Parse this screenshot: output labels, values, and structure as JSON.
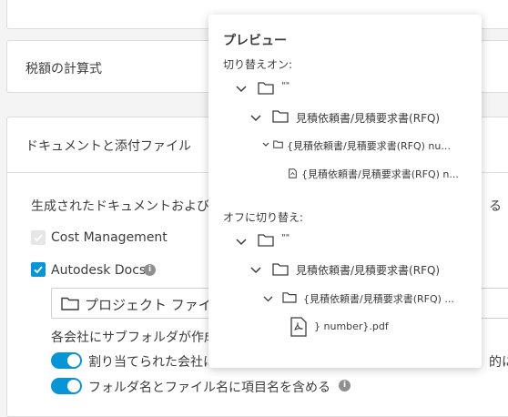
{
  "sections": {
    "tax_calc_title": "税額の計算式",
    "documents_title": "ドキュメントと添付ファイル",
    "generated_docs_text": "生成されたドキュメントおよび",
    "generated_docs_tail": "る",
    "cost_management_label": "Cost Management",
    "autodesk_docs_label": "Autodesk Docs",
    "project_files_label": "プロジェクト ファイル",
    "subfolder_text": "各会社にサブフォルダが作成",
    "toggle1_label": "割り当てられた会社に",
    "toggle1_tail": "的に",
    "toggle2_label": "フォルダ名とファイル名に項目名を含める"
  },
  "preview": {
    "title": "プレビュー",
    "on_label": "切り替えオン:",
    "off_label": "オフに切り替え:",
    "on_tree": {
      "root": "\"\"",
      "folder1": "見積依頼書/見積要求書(RFQ)",
      "folder2": "{見積依頼書/見積要求書(RFQ) nu...",
      "file": "{見積依頼書/見積要求書(RFQ) n..."
    },
    "off_tree": {
      "root": "\"\"",
      "folder1": "見積依頼書/見積要求書(RFQ)",
      "folder2": "{見積依頼書/見積要求書(RFQ) ...",
      "file": "} number}.pdf"
    }
  },
  "colors": {
    "accent": "#0696d7",
    "background": "#f4f4f4",
    "border": "#dcdcdc"
  }
}
